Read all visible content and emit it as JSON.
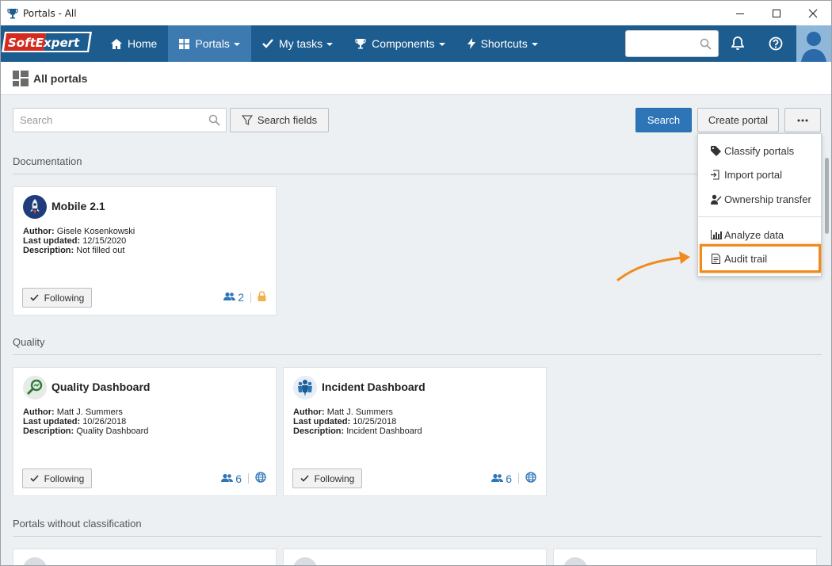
{
  "window": {
    "title": "Portals - All"
  },
  "navbar": {
    "logo_text": "SoftExpert",
    "items": [
      {
        "label": "Home",
        "icon": "home-icon",
        "has_caret": false
      },
      {
        "label": "Portals",
        "icon": "portals-grid-icon",
        "has_caret": true
      },
      {
        "label": "My tasks",
        "icon": "checkmark-icon",
        "has_caret": true
      },
      {
        "label": "Components",
        "icon": "trophy-icon",
        "has_caret": true
      },
      {
        "label": "Shortcuts",
        "icon": "lightning-icon",
        "has_caret": true
      }
    ],
    "search_value": ""
  },
  "page": {
    "title": "All portals"
  },
  "toolbar": {
    "search_placeholder": "Search",
    "search_fields_label": "Search fields",
    "search_label": "Search",
    "create_portal_label": "Create portal",
    "more_label": "···"
  },
  "dropdown": {
    "items": [
      {
        "label": "Classify portals",
        "icon": "tag-icon"
      },
      {
        "label": "Import portal",
        "icon": "import-icon"
      },
      {
        "label": "Ownership transfer",
        "icon": "user-transfer-icon"
      },
      {
        "label": "Analyze data",
        "icon": "bar-chart-icon"
      },
      {
        "label": "Audit trail",
        "icon": "document-icon"
      }
    ]
  },
  "sections": [
    {
      "title": "Documentation",
      "cards": [
        {
          "title": "Mobile 2.1",
          "author": "Gisele Kosenkowski",
          "last_updated": "12/15/2020",
          "description": "Not filled out",
          "follow_label": "Following",
          "members": "2",
          "access_icon": "lock-icon"
        }
      ]
    },
    {
      "title": "Quality",
      "cards": [
        {
          "title": "Quality Dashboard",
          "author": "Matt J. Summers",
          "last_updated": "10/26/2018",
          "description": "Quality Dashboard",
          "follow_label": "Following",
          "members": "6",
          "access_icon": "globe-icon"
        },
        {
          "title": "Incident Dashboard",
          "author": "Matt J. Summers",
          "last_updated": "10/25/2018",
          "description": "Incident Dashboard",
          "follow_label": "Following",
          "members": "6",
          "access_icon": "globe-icon"
        }
      ]
    },
    {
      "title": "Portals without classification",
      "cards": []
    }
  ],
  "labels": {
    "author": "Author:",
    "last_updated": "Last updated:",
    "description": "Description:"
  },
  "colors": {
    "navbar": "#1d5c8f",
    "accent": "#2e75b8",
    "highlight": "#f08a1c"
  }
}
